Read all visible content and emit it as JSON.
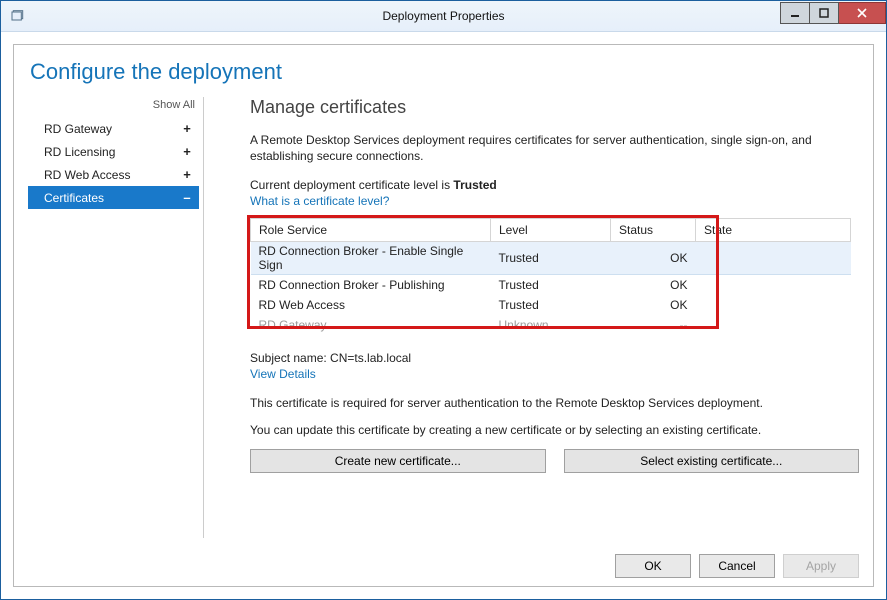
{
  "window": {
    "title": "Deployment Properties"
  },
  "page": {
    "heading": "Configure the deployment"
  },
  "sidebar": {
    "show_all": "Show All",
    "items": [
      {
        "label": "RD Gateway",
        "expand": "+",
        "selected": false
      },
      {
        "label": "RD Licensing",
        "expand": "+",
        "selected": false
      },
      {
        "label": "RD Web Access",
        "expand": "+",
        "selected": false
      },
      {
        "label": "Certificates",
        "expand": "–",
        "selected": true
      }
    ]
  },
  "main": {
    "section_title": "Manage certificates",
    "intro": "A Remote Desktop Services deployment requires certificates for server authentication, single sign-on, and establishing secure connections.",
    "current_level_prefix": "Current deployment certificate level is ",
    "current_level_value": "Trusted",
    "what_is_link": "What is a certificate level?",
    "table": {
      "headers": {
        "role": "Role Service",
        "level": "Level",
        "status": "Status",
        "state": "State"
      },
      "rows": [
        {
          "role": "RD Connection Broker - Enable Single Sign",
          "level": "Trusted",
          "status": "OK",
          "state": "",
          "selected": true,
          "disabled": false
        },
        {
          "role": "RD Connection Broker - Publishing",
          "level": "Trusted",
          "status": "OK",
          "state": "",
          "selected": false,
          "disabled": false
        },
        {
          "role": "RD Web Access",
          "level": "Trusted",
          "status": "OK",
          "state": "",
          "selected": false,
          "disabled": false
        },
        {
          "role": "RD Gateway",
          "level": "Unknown",
          "status": "--",
          "state": "",
          "selected": false,
          "disabled": true
        }
      ]
    },
    "subject_label": "Subject name: ",
    "subject_value": "CN=ts.lab.local",
    "view_details": "View Details",
    "desc1": "This certificate is required for server authentication to the Remote Desktop Services deployment.",
    "desc2": "You can update this certificate by creating a new certificate or by selecting an existing certificate.",
    "create_btn": "Create new certificate...",
    "select_btn": "Select existing certificate..."
  },
  "footer": {
    "ok": "OK",
    "cancel": "Cancel",
    "apply": "Apply"
  }
}
